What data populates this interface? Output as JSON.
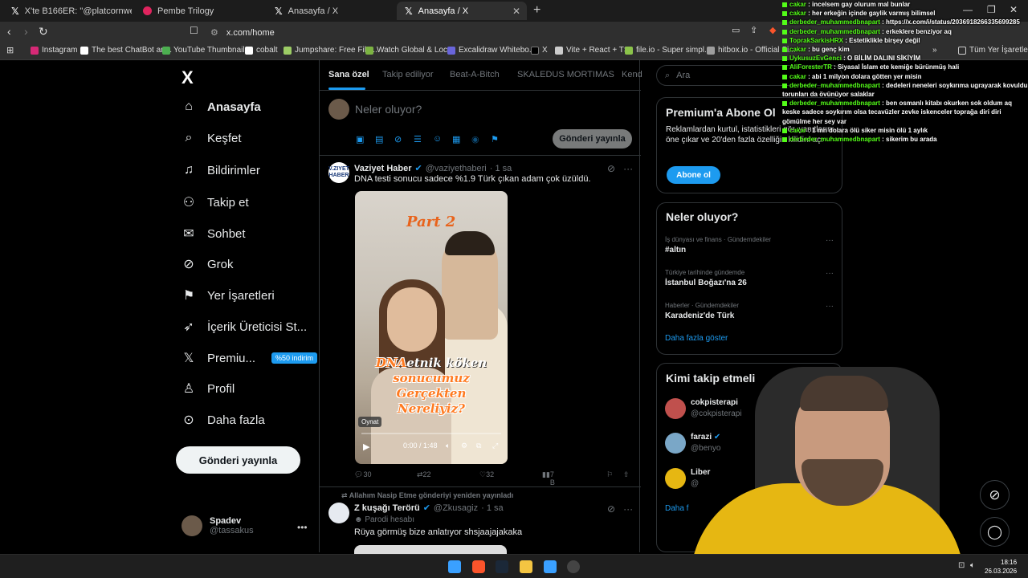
{
  "browser": {
    "tabs": [
      {
        "label": "X'te B166ER: \"@platcornweb 15 yıl d",
        "icon": "x-logo"
      },
      {
        "label": "Pembe Trilogy",
        "icon": "pink-circle"
      },
      {
        "label": "Anasayfa / X",
        "icon": "x-logo"
      },
      {
        "label": "Anasayfa / X",
        "icon": "x-logo"
      }
    ],
    "url": "x.com/home",
    "bookmarks": [
      "Instagram",
      "The best ChatBot an...",
      "YouTube Thumbnail...",
      "cobalt",
      "Jumpshare: Free File...",
      "Watch Global & Loc...",
      "Excalidraw Whitebo...",
      "X",
      "Vite + React + TS",
      "file.io - Super simpl...",
      "hitbox.io - Official Si...",
      "Tüm Yer İşaretleri"
    ],
    "more_bookmarks": "»"
  },
  "nav": {
    "logo": "X",
    "items": [
      {
        "label": "Anasayfa",
        "icon": "home-icon"
      },
      {
        "label": "Keşfet",
        "icon": "search-icon"
      },
      {
        "label": "Bildirimler",
        "icon": "bell-icon"
      },
      {
        "label": "Takip et",
        "icon": "add-user-icon"
      },
      {
        "label": "Sohbet",
        "icon": "mail-icon"
      },
      {
        "label": "Grok",
        "icon": "grok-icon"
      },
      {
        "label": "Yer İşaretleri",
        "icon": "bookmark-icon"
      },
      {
        "label": "İçerik Üreticisi St...",
        "icon": "rocket-icon"
      },
      {
        "label": "Premiu...",
        "icon": "x-premium-icon"
      },
      {
        "label": "Profil",
        "icon": "profile-icon"
      },
      {
        "label": "Daha fazla",
        "icon": "more-circle-icon"
      }
    ],
    "premium_badge": "%50 indirim",
    "post_button": "Gönderi yayınla",
    "account": {
      "name": "Spadev",
      "handle": "@tassakus"
    }
  },
  "feed": {
    "tabs": [
      "Sana özel",
      "Takip ediliyor",
      "Beat-A-Bitch",
      "SKALEDUS MORTIMAS",
      "Kend"
    ],
    "compose_placeholder": "Neler oluyor?",
    "share_button": "Gönderi yayınla",
    "post1": {
      "avatar_text": "V.ZIYET HABER",
      "name": "Vaziyet Haber",
      "handle": "@vaziyethaberi",
      "time": "· 1 sa",
      "text": "DNA testi sonucu sadece %1.9 Türk çıkan adam çok üzüldü.",
      "video": {
        "overlay_title": "Part 2",
        "caption_1": "DNA",
        "caption_2": "etnik köken",
        "caption_3": "sonucumuz",
        "caption_4": "Gerçekten Nereliyiz?",
        "tooltip": "Oynat",
        "time": "0:00 / 1:48"
      },
      "stats": {
        "replies": "30",
        "reposts": "22",
        "likes": "32",
        "views": "7 B"
      }
    },
    "repost_note": "Allahım Nasip Etme gönderiyi yeniden yayınladı",
    "post2": {
      "name": "Z kuşağı Terörü",
      "handle": "@Zkusagiz",
      "time": "· 1 sa",
      "sub": "Parodi hesabı",
      "text": "Rüya görmüş bize anlatıyor shsjaajajakaka"
    }
  },
  "sidebar": {
    "search_placeholder": "Ara",
    "premium": {
      "title": "Premium'a Abone Ol",
      "body": "Reklamlardan kurtul, istatistikleri gör, yanıtlarını öne çıkar ve 20'den fazla özelliğin kilidini aç.",
      "button": "Abone ol"
    },
    "trends": {
      "title": "Neler oluyor?",
      "items": [
        {
          "category": "İş dünyası ve finans · Gündemdekiler",
          "name": "#altın"
        },
        {
          "category": "Türkiye tarihinde gündemde",
          "name": "İstanbul Boğazı'na 26"
        },
        {
          "category": "Haberler · Gündemdekiler",
          "name": "Karadeniz'de Türk"
        }
      ],
      "show_more": "Daha fazla göster"
    },
    "who_to_follow": {
      "title": "Kimi takip etmeli",
      "items": [
        {
          "name": "cokpisterapi",
          "handle": "@cokpisterapi"
        },
        {
          "name": "farazi",
          "handle": "@benyo"
        },
        {
          "name": "Liber",
          "handle": "@"
        }
      ],
      "show_more": "Daha f"
    }
  },
  "chat": [
    {
      "user": "cakar",
      "msg": "incelsem gay olurum mal bunlar"
    },
    {
      "user": "cakar",
      "msg": "her erkeğin içinde gaylik varmış bilimsel"
    },
    {
      "user": "derbeder_muhammedbnapart",
      "msg": "https://x.com/i/status/2036918266335699285"
    },
    {
      "user": "derbeder_muhammedbnapart",
      "msg": "erkeklere benziyor aq"
    },
    {
      "user": "ToprakSarkisHRX",
      "msg": "Estetiklikle birşey değil"
    },
    {
      "user": "cakar",
      "msg": "bu genç kim"
    },
    {
      "user": "UykusuzEvGenci",
      "msg": "O BİLİM DALINI SİKİYİM"
    },
    {
      "user": "AliForesterTR",
      "msg": "Siyasal İslam ete kemiğe bürünmüş hali"
    },
    {
      "user": "cakar",
      "msg": "abi 1 milyon dolara götten yer misin"
    },
    {
      "user": "derbeder_muhammedbnapart",
      "msg": "dedeleri neneleri soykırıma ugrayarak kovuldu torunları da övünüyor salaklar"
    },
    {
      "user": "derbeder_muhammedbnapart",
      "msg": "ben osmanlı kitabı okurken sok oldum aq keske sadece soykırım olsa tecavüzler zevke iskenceler toprağa diri diri gömülme her sey var"
    },
    {
      "user": "cakar",
      "msg": "1 mn dolara ölü siker misin ölü 1 aylık"
    },
    {
      "user": "derbeder_muhammedbnapart",
      "msg": "sikerim bu arada"
    }
  ],
  "taskbar": {
    "time": "18:16",
    "date": "26.03.2026"
  }
}
